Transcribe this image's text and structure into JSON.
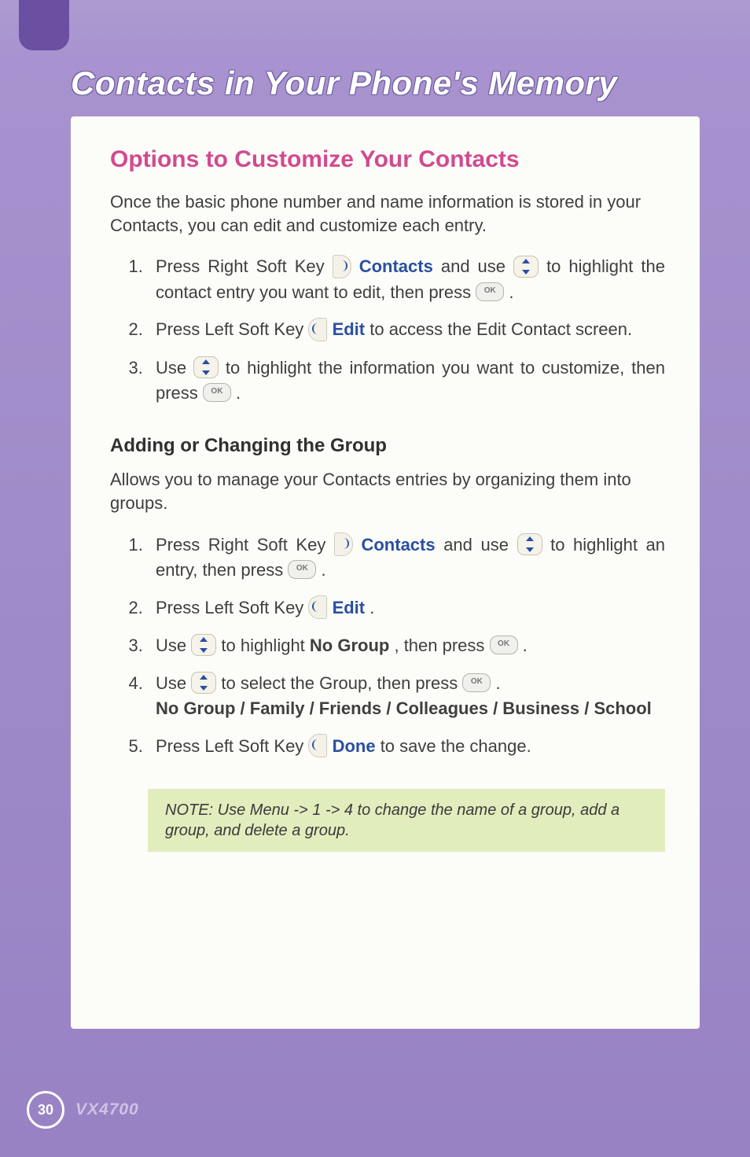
{
  "chapterTitle": "Contacts in Your Phone's Memory",
  "sectionTitle": "Options to Customize Your Contacts",
  "intro": "Once the basic phone number and name information is stored in your Contacts, you can edit and customize each entry.",
  "steps1": {
    "s1a": "Press Right Soft Key ",
    "s1b": "Contacts",
    "s1c": " and use ",
    "s1d": " to highlight the contact entry you want to edit, then press ",
    "s1e": " .",
    "s2a": "Press Left Soft Key ",
    "s2b": "Edit",
    "s2c": " to access the Edit Contact screen.",
    "s3a": "Use ",
    "s3b": " to highlight the information you want to customize, then press ",
    "s3c": " ."
  },
  "subsectionTitle": "Adding or Changing the Group",
  "subIntro": "Allows you to manage your Contacts entries by organizing them into groups.",
  "steps2": {
    "s1a": "Press Right Soft Key ",
    "s1b": "Contacts",
    "s1c": " and use ",
    "s1d": " to highlight an entry, then press ",
    "s1e": " .",
    "s2a": "Press Left Soft Key ",
    "s2b": "Edit",
    "s2c": ".",
    "s3a": "Use ",
    "s3b": " to highlight ",
    "s3c": "No Group",
    "s3d": ", then press ",
    "s3e": " .",
    "s4a": "Use ",
    "s4b": " to select the Group, then press ",
    "s4c": " .",
    "s4d": "No Group / Family / Friends / Colleagues / Business / School",
    "s5a": "Press Left Soft Key ",
    "s5b": "Done",
    "s5c": " to save the change."
  },
  "noteLabel": "NOTE: ",
  "noteBody": "Use Menu -> 1 -> 4 to change the name of a group, add a group, and delete a group.",
  "pageNumber": "30",
  "model": "VX4700",
  "okLabel": "OK"
}
